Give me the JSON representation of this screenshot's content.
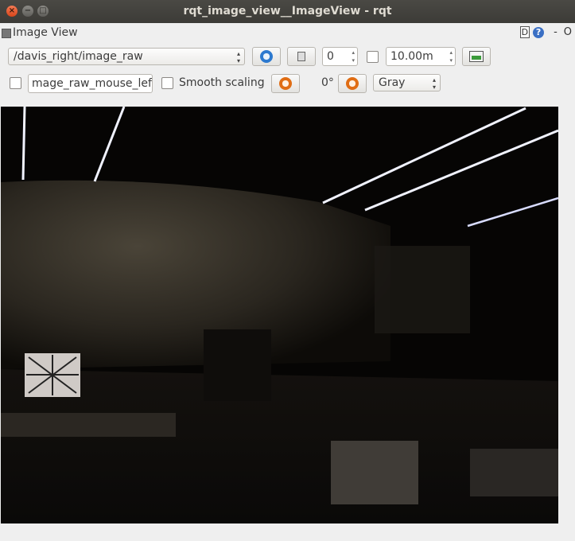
{
  "window": {
    "title": "rqt_image_view__ImageView - rqt",
    "close_glyph": "×",
    "min_glyph": "−",
    "max_glyph": "□"
  },
  "dock": {
    "label": "Image View",
    "d_label": "D",
    "help_label": "?",
    "dash": "-",
    "close_glyph": "O"
  },
  "toolbar": {
    "topic_value": "/davis_right/image_raw",
    "spin_value": "0",
    "duration_value": "10.00m",
    "mouse_topic_value": "mage_raw_mouse_left",
    "smooth_label": "Smooth scaling",
    "rotation_label": "0°",
    "colormap_value": "Gray",
    "arrow_up": "▴",
    "arrow_down": "▾"
  }
}
